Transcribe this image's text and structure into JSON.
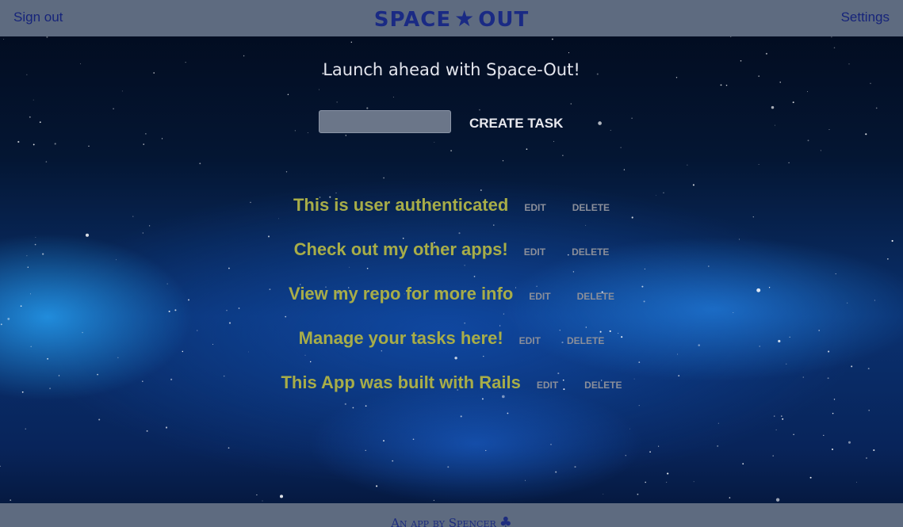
{
  "header": {
    "sign_out": "Sign out",
    "brand_left": "SPACE",
    "brand_star": "★",
    "brand_right": "OUT",
    "settings": "Settings"
  },
  "main": {
    "tagline": "Launch ahead with Space-Out!",
    "task_input": {
      "value": "",
      "placeholder": ""
    },
    "create_button": "CREATE TASK"
  },
  "tasks": [
    {
      "title": "This is user authenticated",
      "edit": "EDIT",
      "delete": "DELETE"
    },
    {
      "title": "Check out my other apps!",
      "edit": "EDIT",
      "delete": "DELETE"
    },
    {
      "title": "View my repo for more info",
      "edit": "EDIT",
      "delete": "DELETE"
    },
    {
      "title": "Manage your tasks here!",
      "edit": "EDIT",
      "delete": "DELETE"
    },
    {
      "title": "This App was built with Rails",
      "edit": "EDIT",
      "delete": "DELETE"
    }
  ],
  "footer": {
    "text": "An app by Spencer",
    "icon": "club-icon",
    "icon_glyph": "♣"
  },
  "colors": {
    "bars": "#5e6b80",
    "brand_navy": "#1a2a84",
    "task_title": "#a8ad48",
    "task_action": "#8b8f9a"
  }
}
